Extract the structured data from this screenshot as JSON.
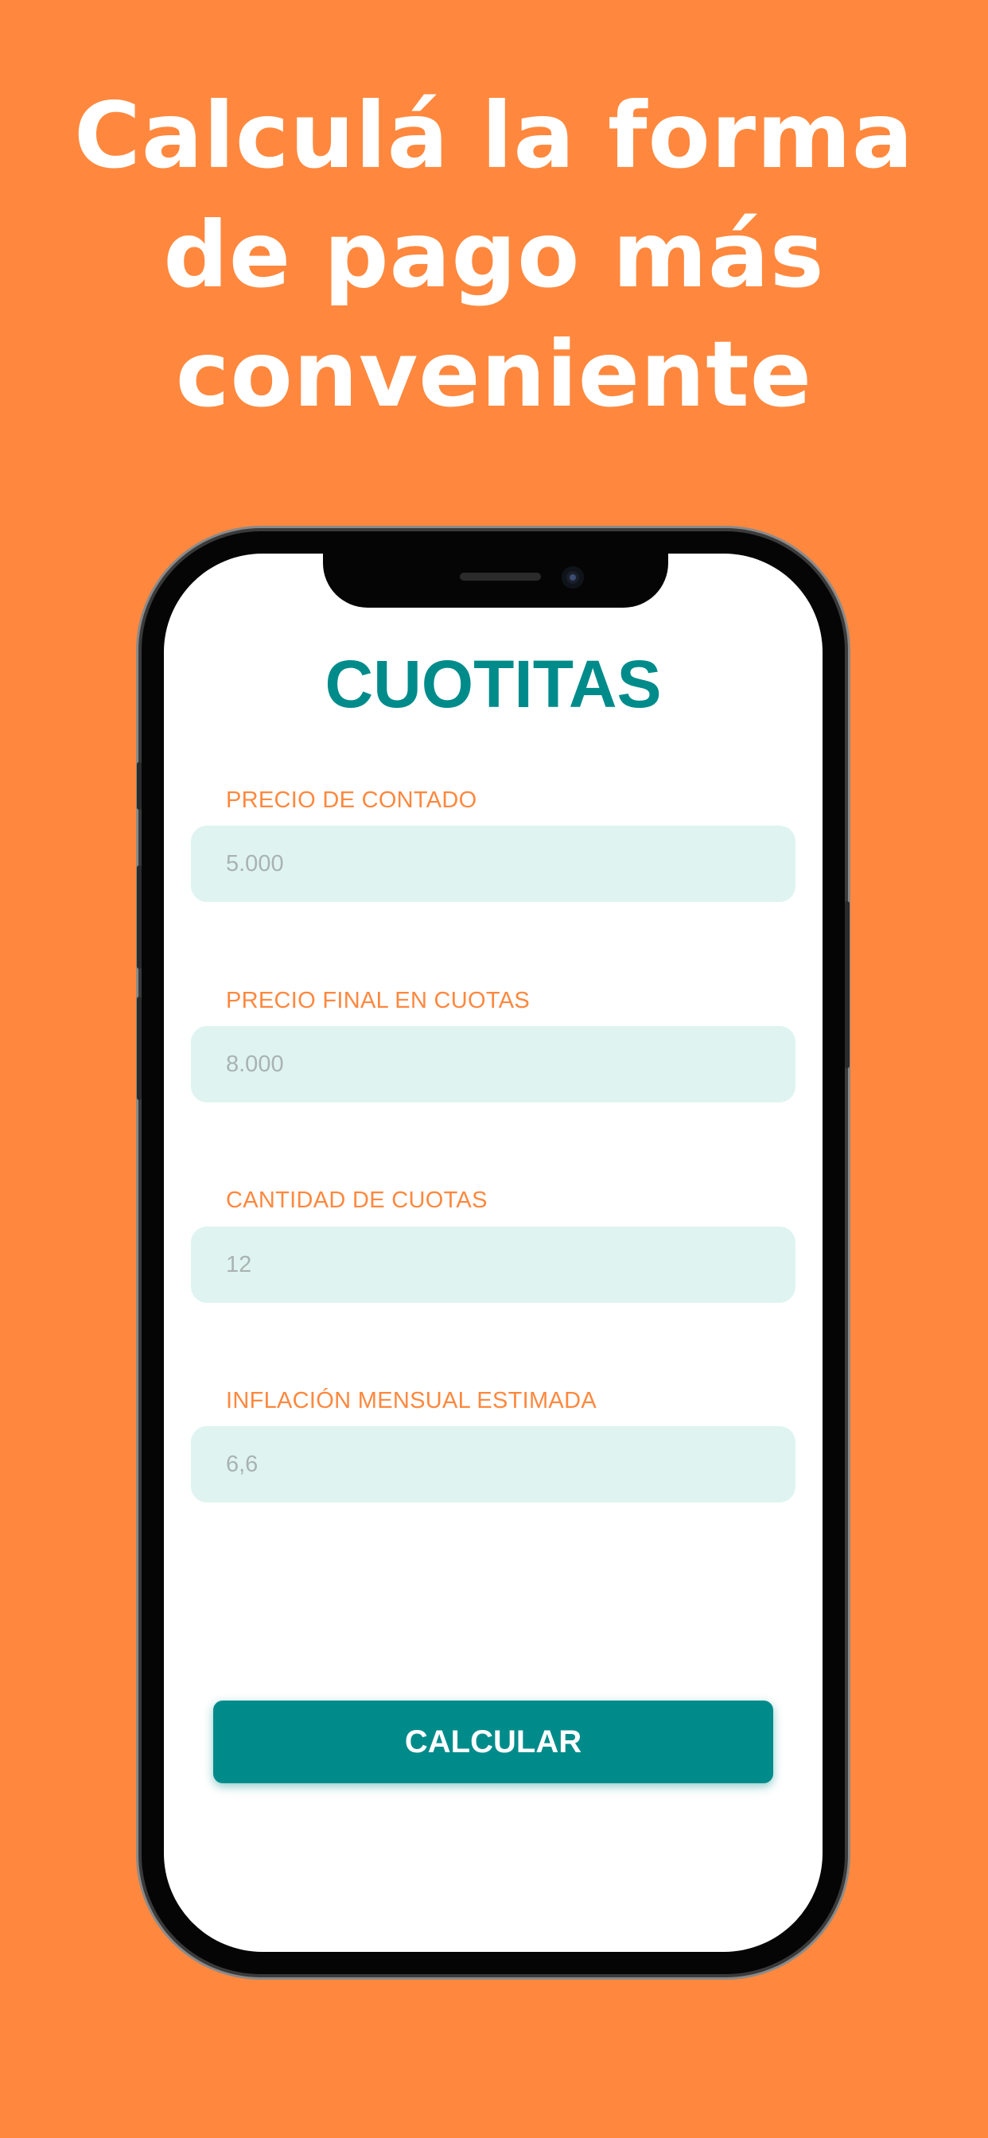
{
  "headline": {
    "line1": "Calculá la forma",
    "line2": "de pago más",
    "line3": "conveniente"
  },
  "app": {
    "title": "CUOTITAS"
  },
  "form": {
    "fields": [
      {
        "label": "PRECIO DE CONTADO",
        "placeholder": "5.000"
      },
      {
        "label": "PRECIO FINAL EN CUOTAS",
        "placeholder": "8.000"
      },
      {
        "label": "CANTIDAD DE CUOTAS",
        "placeholder": "12"
      },
      {
        "label": "INFLACIÓN MENSUAL ESTIMADA",
        "placeholder": "6,6"
      }
    ],
    "submit_label": "CALCULAR"
  },
  "colors": {
    "background": "#FF883E",
    "accent": "#008B8B",
    "label": "#FF883E",
    "input_bg": "#DFF4F1"
  }
}
